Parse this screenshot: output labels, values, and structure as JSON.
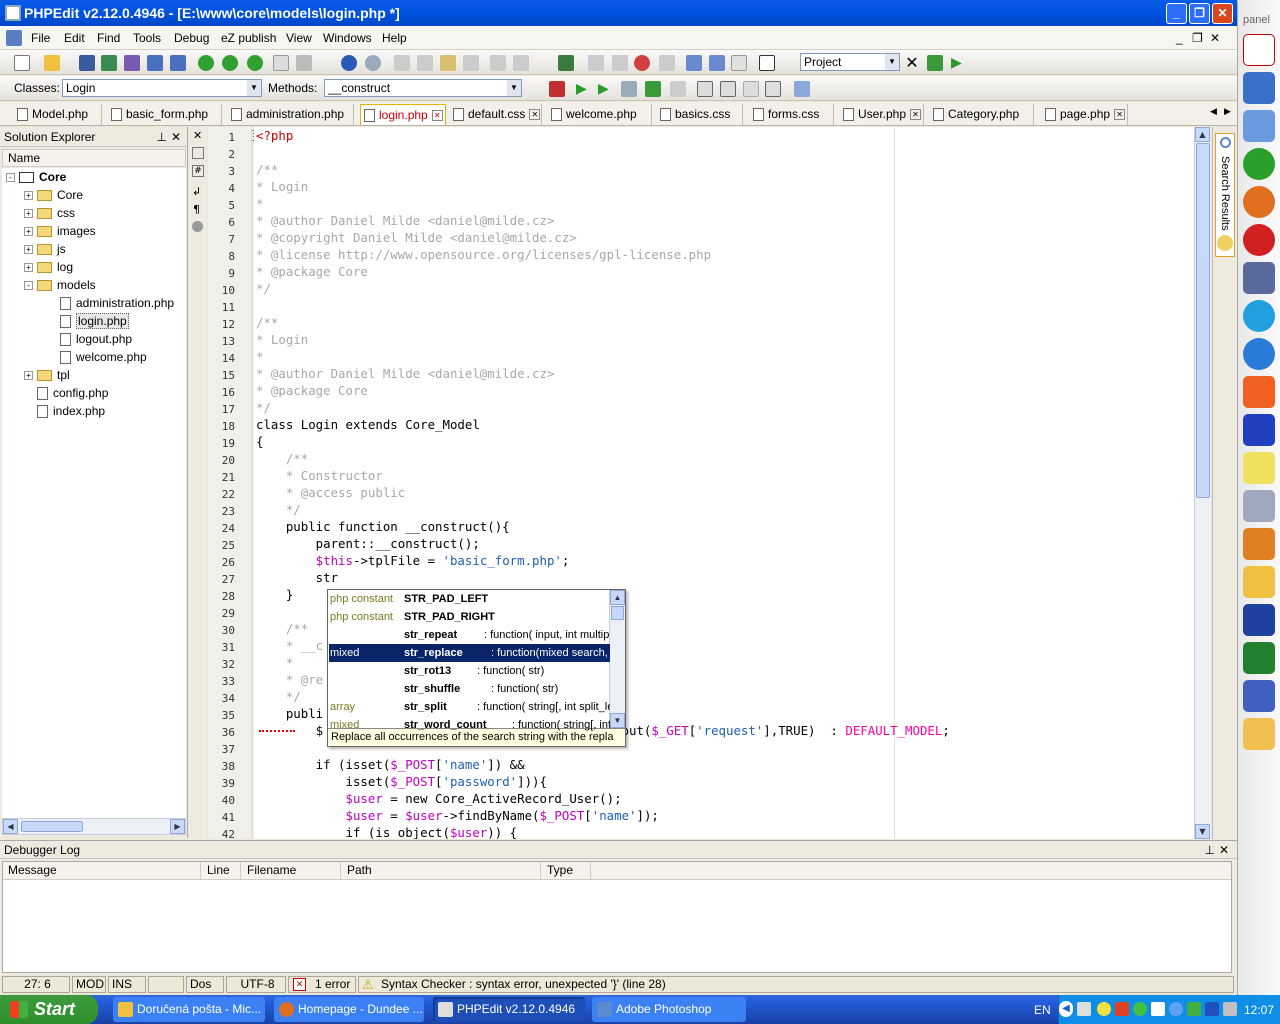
{
  "window": {
    "title": "PHPEdit v2.12.0.4946 - [E:\\www\\core\\models\\login.php *]"
  },
  "menu": [
    "File",
    "Edit",
    "Find",
    "Tools",
    "Debug",
    "eZ publish",
    "View",
    "Windows",
    "Help"
  ],
  "toolbar": {
    "project_value": "Project",
    "classes_label": "Classes:",
    "classes_value": "Login",
    "methods_label": "Methods:",
    "methods_value": "__construct"
  },
  "tabs": [
    "Model.php",
    "basic_form.php",
    "administration.php",
    "login.php",
    "default.css",
    "welcome.php",
    "basics.css",
    "forms.css",
    "User.php",
    "Category.php",
    "page.php"
  ],
  "active_tab": "login.php",
  "solution": {
    "title": "Solution Explorer",
    "column": "Name",
    "nodes": [
      {
        "label": "Core",
        "level": 0,
        "kind": "project",
        "exp": "-"
      },
      {
        "label": "Core",
        "level": 1,
        "kind": "folder",
        "exp": "+"
      },
      {
        "label": "css",
        "level": 1,
        "kind": "folder",
        "exp": "+"
      },
      {
        "label": "images",
        "level": 1,
        "kind": "folder",
        "exp": "+"
      },
      {
        "label": "js",
        "level": 1,
        "kind": "folder",
        "exp": "+"
      },
      {
        "label": "log",
        "level": 1,
        "kind": "folder",
        "exp": "+"
      },
      {
        "label": "models",
        "level": 1,
        "kind": "folder",
        "exp": "-"
      },
      {
        "label": "administration.php",
        "level": 2,
        "kind": "file",
        "exp": ""
      },
      {
        "label": "login.php",
        "level": 2,
        "kind": "file",
        "exp": ""
      },
      {
        "label": "logout.php",
        "level": 2,
        "kind": "file",
        "exp": ""
      },
      {
        "label": "welcome.php",
        "level": 2,
        "kind": "file",
        "exp": ""
      },
      {
        "label": "tpl",
        "level": 1,
        "kind": "folder",
        "exp": "+"
      },
      {
        "label": "config.php",
        "level": 1,
        "kind": "file",
        "exp": ""
      },
      {
        "label": "index.php",
        "level": 1,
        "kind": "file",
        "exp": ""
      }
    ]
  },
  "editor": {
    "line_numbers": [
      "1",
      "2",
      "3",
      "4",
      "5",
      "6",
      "7",
      "8",
      "9",
      "10",
      "11",
      "12",
      "13",
      "14",
      "15",
      "16",
      "17",
      "18",
      "19",
      "20",
      "21",
      "22",
      "23",
      "24",
      "25",
      "26",
      "27",
      "28",
      "29",
      "30",
      "31",
      "32",
      "33",
      "34",
      "35",
      "36",
      "37",
      "38",
      "39",
      "40",
      "41",
      "42"
    ],
    "lines": [
      [
        [
          "ph",
          "<?php"
        ]
      ],
      [],
      [
        [
          "cm",
          "/**"
        ]
      ],
      [
        [
          "cm",
          "* Login"
        ]
      ],
      [
        [
          "cm",
          "*"
        ]
      ],
      [
        [
          "cm",
          "* @author Daniel Milde <daniel@milde.cz>"
        ]
      ],
      [
        [
          "cm",
          "* @copyright Daniel Milde <daniel@milde.cz>"
        ]
      ],
      [
        [
          "cm",
          "* @license http://www.opensource.org/licenses/gpl-license.php"
        ]
      ],
      [
        [
          "cm",
          "* @package Core"
        ]
      ],
      [
        [
          "cm",
          "*/"
        ]
      ],
      [],
      [
        [
          "cm",
          "/**"
        ]
      ],
      [
        [
          "cm",
          "* Login"
        ]
      ],
      [
        [
          "cm",
          "*"
        ]
      ],
      [
        [
          "cm",
          "* @author Daniel Milde <daniel@milde.cz>"
        ]
      ],
      [
        [
          "cm",
          "* @package Core"
        ]
      ],
      [
        [
          "cm",
          "*/"
        ]
      ],
      [
        [
          "kw",
          "class Login extends Core_Model"
        ]
      ],
      [
        [
          "kw",
          "{"
        ]
      ],
      [
        [
          "cm",
          "    /**"
        ]
      ],
      [
        [
          "cm",
          "    * Constructor"
        ]
      ],
      [
        [
          "cm",
          "    * @access public"
        ]
      ],
      [
        [
          "cm",
          "    */"
        ]
      ],
      [
        [
          "kw",
          "    public function __construct(){"
        ]
      ],
      [
        [
          "kw",
          "        parent::__construct();"
        ]
      ],
      [
        [
          "vr",
          "        $this"
        ],
        [
          "kw",
          "->tplFile = "
        ],
        [
          "st",
          "'basic_form.php'"
        ],
        [
          "kw",
          ";"
        ]
      ],
      [
        [
          "kw",
          "        str"
        ]
      ],
      [
        [
          "kw",
          "    }"
        ]
      ],
      [],
      [
        [
          "cm",
          "    /**"
        ]
      ],
      [
        [
          "cm",
          "    * __c"
        ]
      ],
      [
        [
          "cm",
          "    *"
        ]
      ],
      [
        [
          "cm",
          "    * @re"
        ]
      ],
      [
        [
          "cm",
          "    */"
        ]
      ],
      [
        [
          "kw",
          "    publi"
        ]
      ],
      [
        [
          "kw",
          "        $"
        ],
        [
          "kw",
          "                                      utput("
        ],
        [
          "vr",
          "$_GET"
        ],
        [
          "kw",
          "["
        ],
        [
          "st",
          "'request'"
        ],
        [
          "kw",
          "],TRUE)  : "
        ],
        [
          "cn",
          "DEFAULT_MODEL"
        ],
        [
          "kw",
          ";"
        ]
      ],
      [],
      [
        [
          "kw",
          "        if (isset("
        ],
        [
          "vr",
          "$_POST"
        ],
        [
          "kw",
          "["
        ],
        [
          "st",
          "'name'"
        ],
        [
          "kw",
          "]) &&"
        ]
      ],
      [
        [
          "kw",
          "            isset("
        ],
        [
          "vr",
          "$_POST"
        ],
        [
          "kw",
          "["
        ],
        [
          "st",
          "'password'"
        ],
        [
          "kw",
          "])){"
        ]
      ],
      [
        [
          "vr",
          "            $user"
        ],
        [
          "kw",
          " = new Core_ActiveRecord_User();"
        ]
      ],
      [
        [
          "vr",
          "            $user"
        ],
        [
          "kw",
          " = "
        ],
        [
          "vr",
          "$user"
        ],
        [
          "kw",
          "->findByName("
        ],
        [
          "vr",
          "$_POST"
        ],
        [
          "kw",
          "["
        ],
        [
          "st",
          "'name'"
        ],
        [
          "kw",
          "]);"
        ]
      ],
      [
        [
          "kw",
          "            if (is_object("
        ],
        [
          "vr",
          "$user"
        ],
        [
          "kw",
          ")) {"
        ]
      ]
    ]
  },
  "autocomplete": {
    "items": [
      {
        "type": "php constant",
        "name": "STR_PAD_LEFT",
        "sig": ""
      },
      {
        "type": "php constant",
        "name": "STR_PAD_RIGHT",
        "sig": ""
      },
      {
        "type": "",
        "name": "str_repeat",
        "sig": ": function( input, int multiplie"
      },
      {
        "type": "mixed",
        "name": "str_replace",
        "sig": ": function(mixed search, mi"
      },
      {
        "type": "",
        "name": "str_rot13",
        "sig": ": function( str)"
      },
      {
        "type": "",
        "name": "str_shuffle",
        "sig": ": function( str)"
      },
      {
        "type": "array",
        "name": "str_split",
        "sig": ": function( string[, int split_leng"
      },
      {
        "type": "mixed",
        "name": "str_word_count",
        "sig": ": function( string[, int"
      }
    ],
    "selected": 3,
    "hint": "Replace all occurrences of the search string with the repla"
  },
  "side_tab": "Search Results",
  "debugger": {
    "title": "Debugger Log",
    "columns": [
      "Message",
      "Line",
      "Filename",
      "Path",
      "Type"
    ]
  },
  "status": {
    "pos": "27:  6",
    "mod": "MOD",
    "ins": "INS",
    "eol": "Dos",
    "enc": "UTF-8",
    "errors": "1 error",
    "message": "Syntax Checker : syntax error, unexpected '}' (line 28)"
  },
  "taskbar": {
    "start": "Start",
    "tasks": [
      "Doručená pošta - Mic...",
      "Homepage - Dundee ...",
      "PHPEdit v2.12.0.4946",
      "Adobe Photoshop"
    ],
    "lang": "EN",
    "clock": "12:07"
  },
  "panel_label": "panel"
}
